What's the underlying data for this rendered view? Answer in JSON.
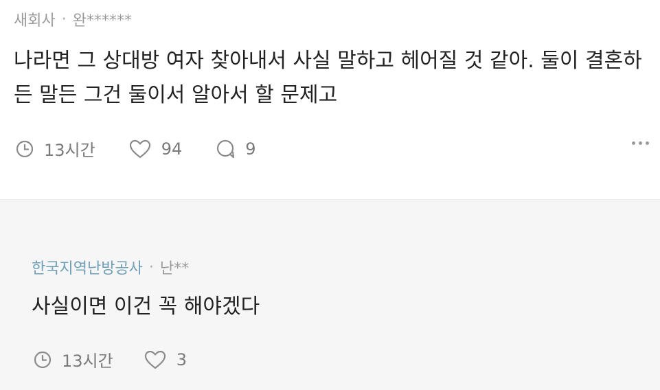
{
  "post": {
    "company": "새회사",
    "separator": "·",
    "author": "완******",
    "text": "나라면 그 상대방 여자 찾아내서 사실 말하고 헤어질 것 같아. 둘이 결혼하든 말든 그건 둘이서 알아서 할 문제고",
    "time": "13시간",
    "likes": "94",
    "comments": "9"
  },
  "reply": {
    "company": "한국지역난방공사",
    "separator": "·",
    "author": "난**",
    "text": "사실이면 이건 꼭 해야겠다",
    "time": "13시간",
    "likes": "3"
  },
  "colors": {
    "company_link": "#6f9fb6",
    "meta_gray": "#9a9a9a",
    "text_dark": "#222222",
    "reply_bg": "#f6f6f6"
  },
  "icons": [
    "clock-icon",
    "heart-icon",
    "comment-icon",
    "more-icon"
  ]
}
